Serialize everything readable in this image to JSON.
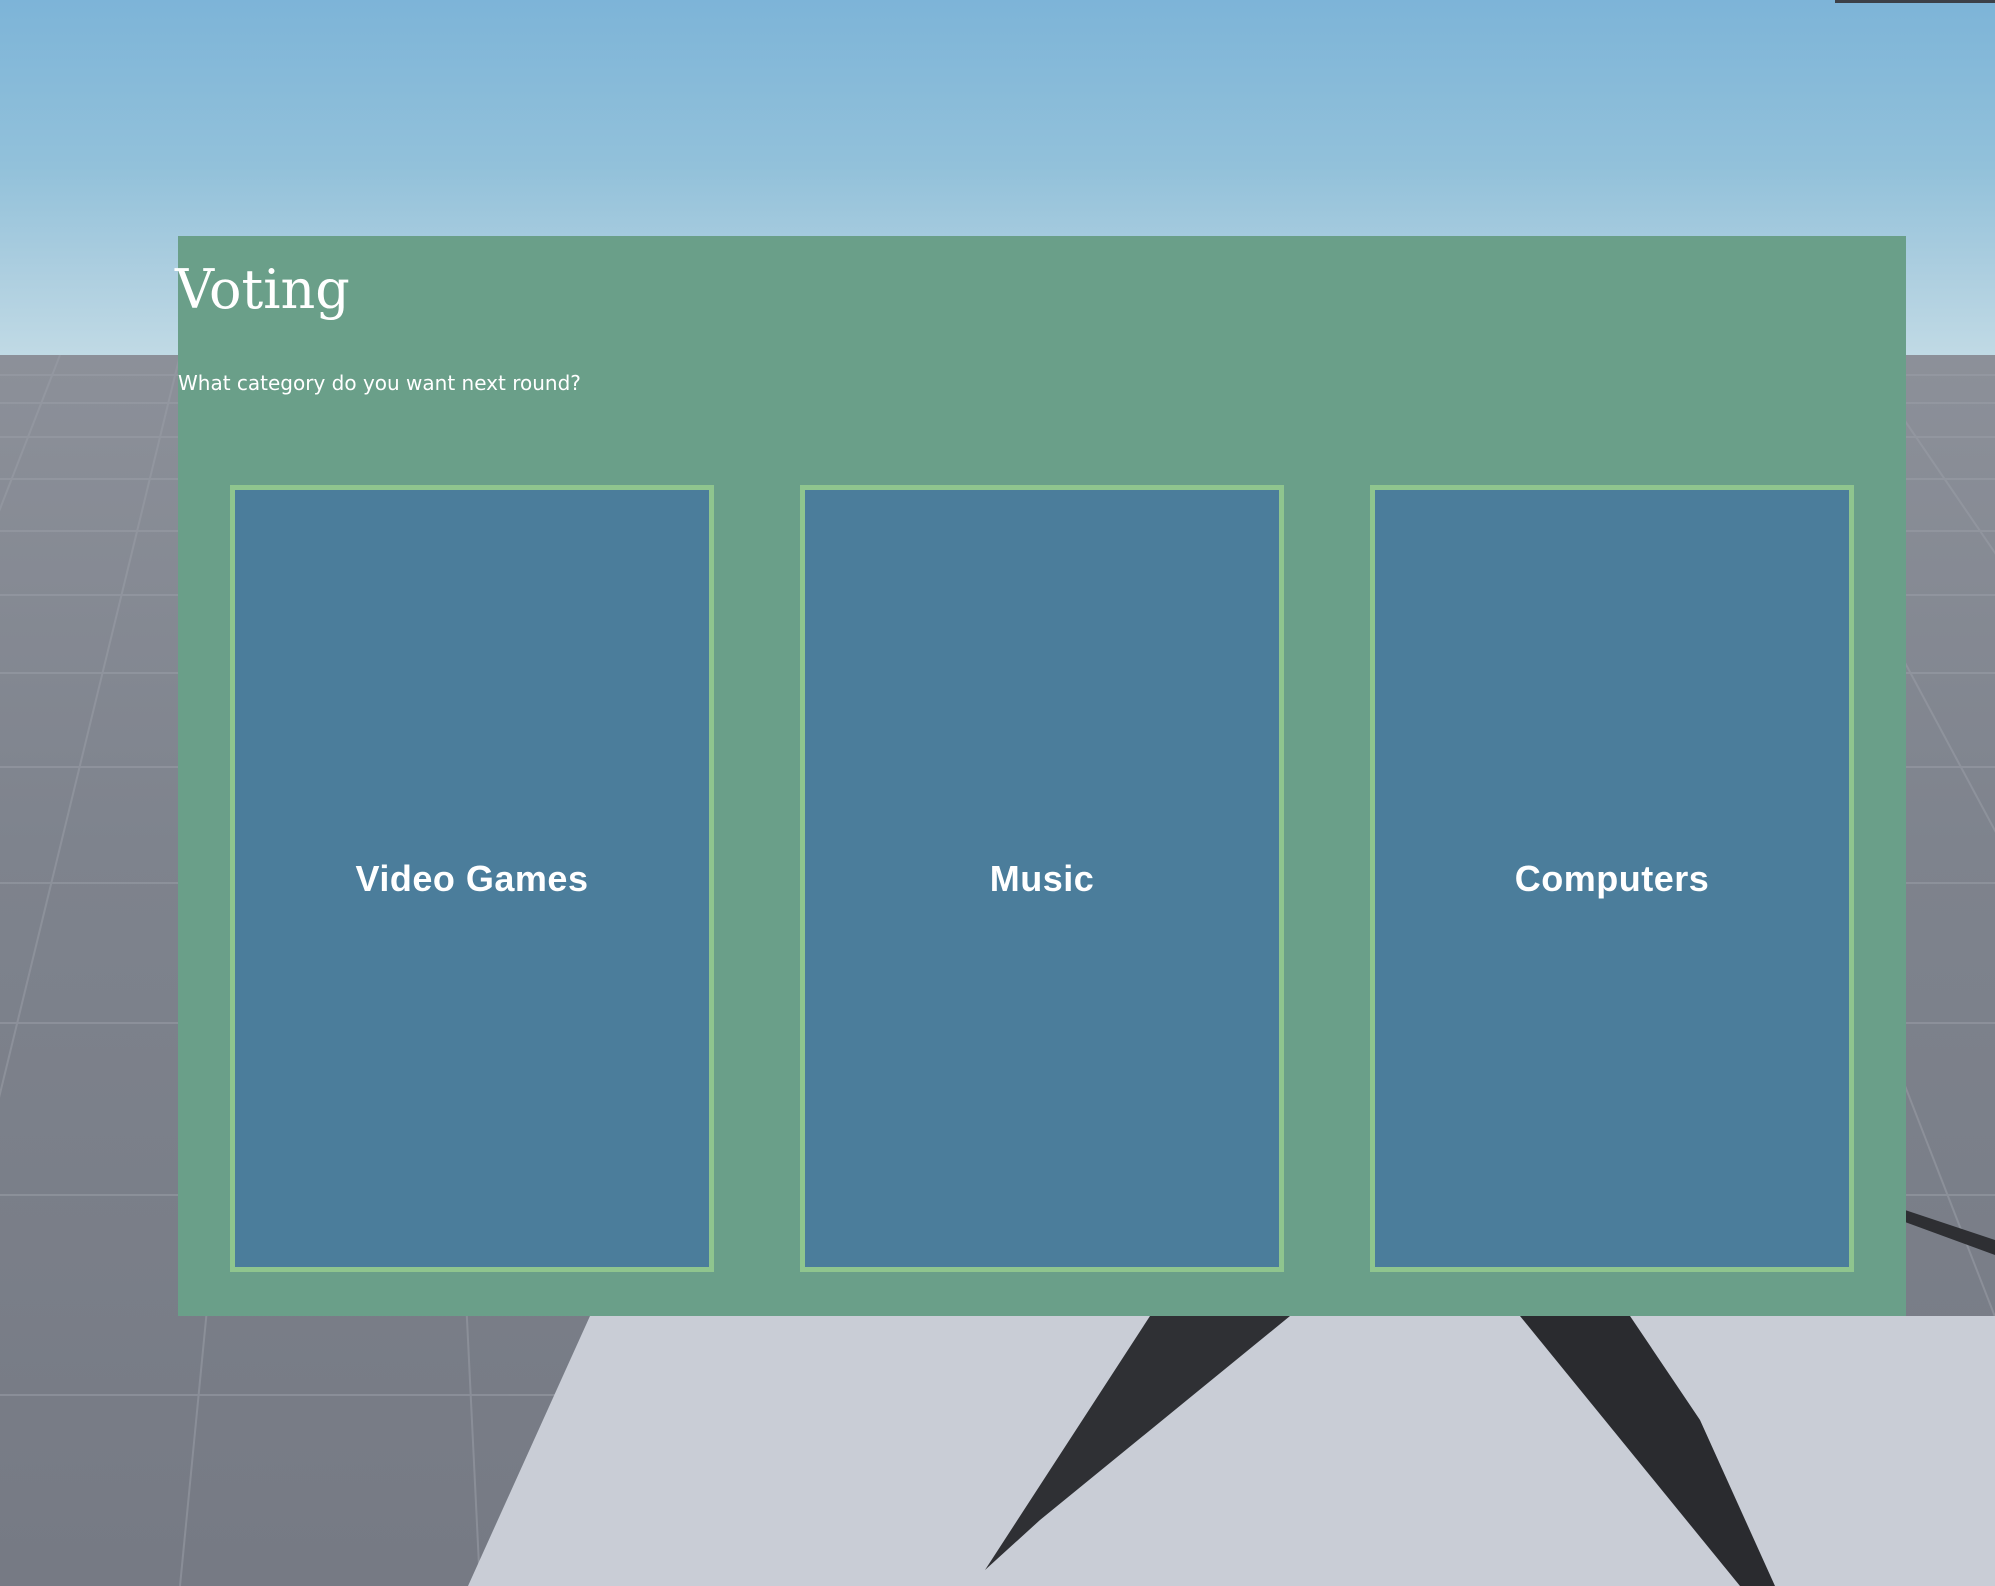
{
  "voting": {
    "title": "Voting",
    "prompt": "What category do you want next round?",
    "options": [
      {
        "label": "Video Games"
      },
      {
        "label": "Music"
      },
      {
        "label": "Computers"
      }
    ]
  },
  "colors": {
    "panel_background": "#6a9f89",
    "card_background": "#4b7d9b",
    "card_border": "#8fc58e",
    "text": "#ffffff",
    "sky": "#7db4d8",
    "floor": "#7e838d"
  }
}
